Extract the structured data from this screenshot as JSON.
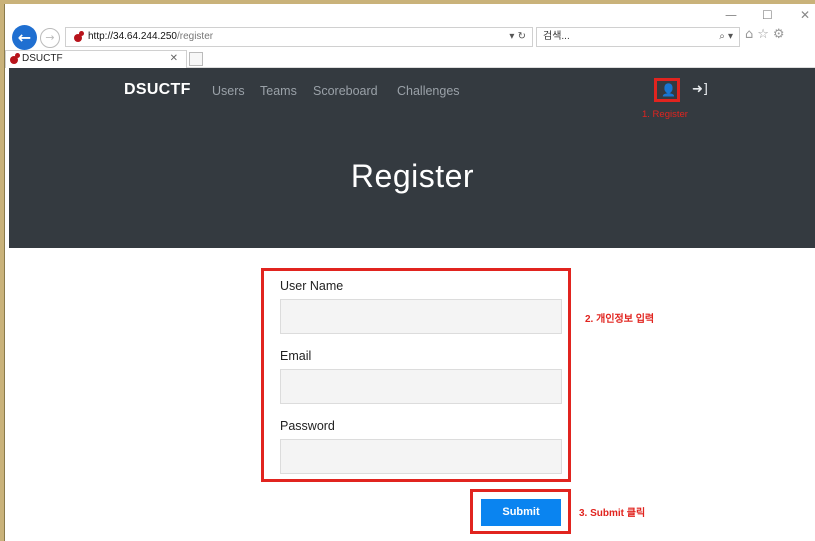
{
  "browser": {
    "url_host": "http://34.64.244.250",
    "url_path": "/register",
    "search_placeholder": "검색...",
    "tab_title": "DSUCTF"
  },
  "site": {
    "brand": "DSUCTF",
    "nav": [
      "Users",
      "Teams",
      "Scoreboard",
      "Challenges"
    ],
    "page_title": "Register"
  },
  "form": {
    "username_label": "User Name",
    "email_label": "Email",
    "password_label": "Password",
    "submit_label": "Submit"
  },
  "annotations": {
    "step1": "1. Register",
    "step2": "2. 개인정보 입력",
    "step3": "3. Submit 클릭"
  },
  "colors": {
    "annotation_red": "#e1241f",
    "navbar_dark": "#343a40",
    "submit_blue": "#0a84f0"
  }
}
